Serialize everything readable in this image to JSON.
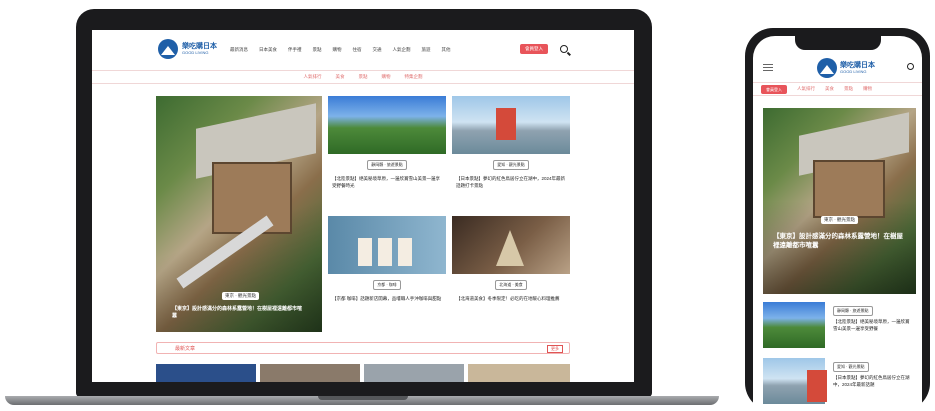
{
  "site": {
    "name": "樂吃購日本",
    "sub": "GOOD LIVING"
  },
  "nav": {
    "menu": [
      "最新消息",
      "日本美食",
      "伴手禮",
      "景點",
      "購物",
      "住宿",
      "交通",
      "人氣企劃",
      "旅遊",
      "其他"
    ],
    "cta": "會員登入"
  },
  "subnav": [
    "人氣排行",
    "美食",
    "景點",
    "購物",
    "特集企劃"
  ],
  "hero": {
    "tag": "東京 · 觀光景點",
    "caption": "【東京】設計感滿分的森林系露營地！在樹屋裡遠離都市喧囂"
  },
  "cards": [
    {
      "tag": "靜岡縣 · 旅遊景點",
      "title": "【北陸景點】絕美秘境草原，一邊欣賞雪山美景一邊享受野餐時光"
    },
    {
      "tag": "愛知 · 觀光景點",
      "title": "【日本景點】夢幻的紅色鳥居佇立在湖中，2024年最新話題打卡景點"
    },
    {
      "tag": "京都 · 咖啡",
      "title": "【京都 咖啡】話題新店開幕，品嚐職人手沖咖啡與甜點"
    },
    {
      "tag": "北海道 · 美食",
      "title": "【北海道美食】冬季限定！必吃的在地暖心料理推薦"
    }
  ],
  "section": {
    "title": "最新文章",
    "more": "更多"
  },
  "phone": {
    "cta": "會員登入",
    "items": [
      {
        "tag": "靜岡縣 · 旅遊景點",
        "title": "【北陸景點】絕美秘境草原，一邊欣賞雪山美景一邊享受野餐"
      },
      {
        "tag": "愛知 · 觀光景點",
        "title": "【日本景點】夢幻的紅色鳥居佇立在湖中，2024年最新話題"
      }
    ]
  }
}
